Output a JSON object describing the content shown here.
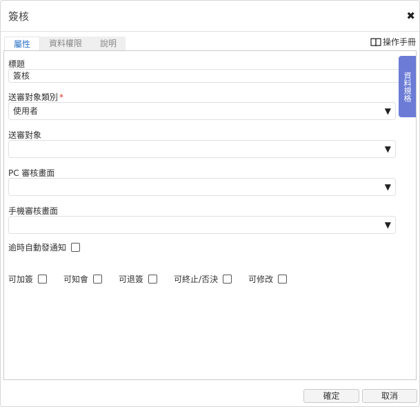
{
  "dialog": {
    "title": "簽核"
  },
  "tabs": [
    {
      "label": "屬性"
    },
    {
      "label": "資料權限"
    },
    {
      "label": "說明"
    }
  ],
  "manual": {
    "label": "操作手冊"
  },
  "side_tab": {
    "label": "資料規格"
  },
  "form": {
    "title_label": "標題",
    "title_value": "簽核",
    "send_type_label": "送審對象類別",
    "send_type_required": "*",
    "send_type_value": "使用者",
    "send_target_label": "送審對象",
    "send_target_value": "",
    "pc_page_label": "PC 審核畫面",
    "pc_page_value": "",
    "mobile_page_label": "手機審核畫面",
    "mobile_page_value": "",
    "auto_notify_label": "逾時自動發通知",
    "arrow": "▼"
  },
  "permissions": [
    {
      "label": "可加簽"
    },
    {
      "label": "可知會"
    },
    {
      "label": "可退簽"
    },
    {
      "label": "可終止/否決"
    },
    {
      "label": "可修改"
    }
  ],
  "footer": {
    "confirm": "確定",
    "cancel": "取消"
  }
}
